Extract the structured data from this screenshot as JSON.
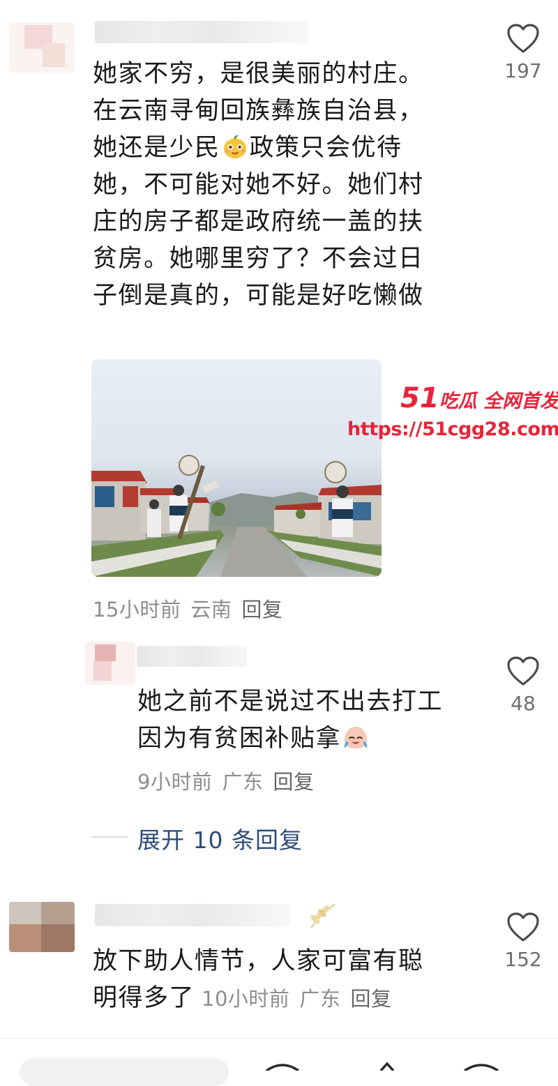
{
  "comments": [
    {
      "text_lines": [
        "她家不穷，是很美丽的村庄。",
        "在云南寻甸回族彝族自治县，",
        "她还是少民",
        "政策只会优待",
        "她，不可能对她不好。她们村",
        "庄的房子都是政府统一盖的扶",
        "贫房。她哪里穷了？不会过日",
        "子倒是真的，可能是好吃懒做"
      ],
      "time": "15小时前",
      "location": "云南",
      "reply_label": "回复",
      "likes": "197",
      "inline_emoji": "smiling-face-emoji"
    },
    {
      "text_lines": [
        "她之前不是说过不出去打工",
        "因为有贫困补贴拿"
      ],
      "time": "9小时前",
      "location": "广东",
      "reply_label": "回复",
      "likes": "48",
      "inline_emoji": "crying-laugh-emoji"
    },
    {
      "text_lines": [
        "放下助人情节，人家可富有聪",
        "明得多了"
      ],
      "time": "10小时前",
      "location": "广东",
      "reply_label": "回复",
      "likes": "152"
    }
  ],
  "expand_replies_label": "展开 10 条回复",
  "watermark": {
    "number": "51",
    "tagline": "吃瓜 全网首发",
    "url": "https://51cgg28.com"
  },
  "colors": {
    "watermark_red": "#e8243a",
    "expand_link_blue": "#2d4c78",
    "meta_gray": "#8e8e8e"
  }
}
